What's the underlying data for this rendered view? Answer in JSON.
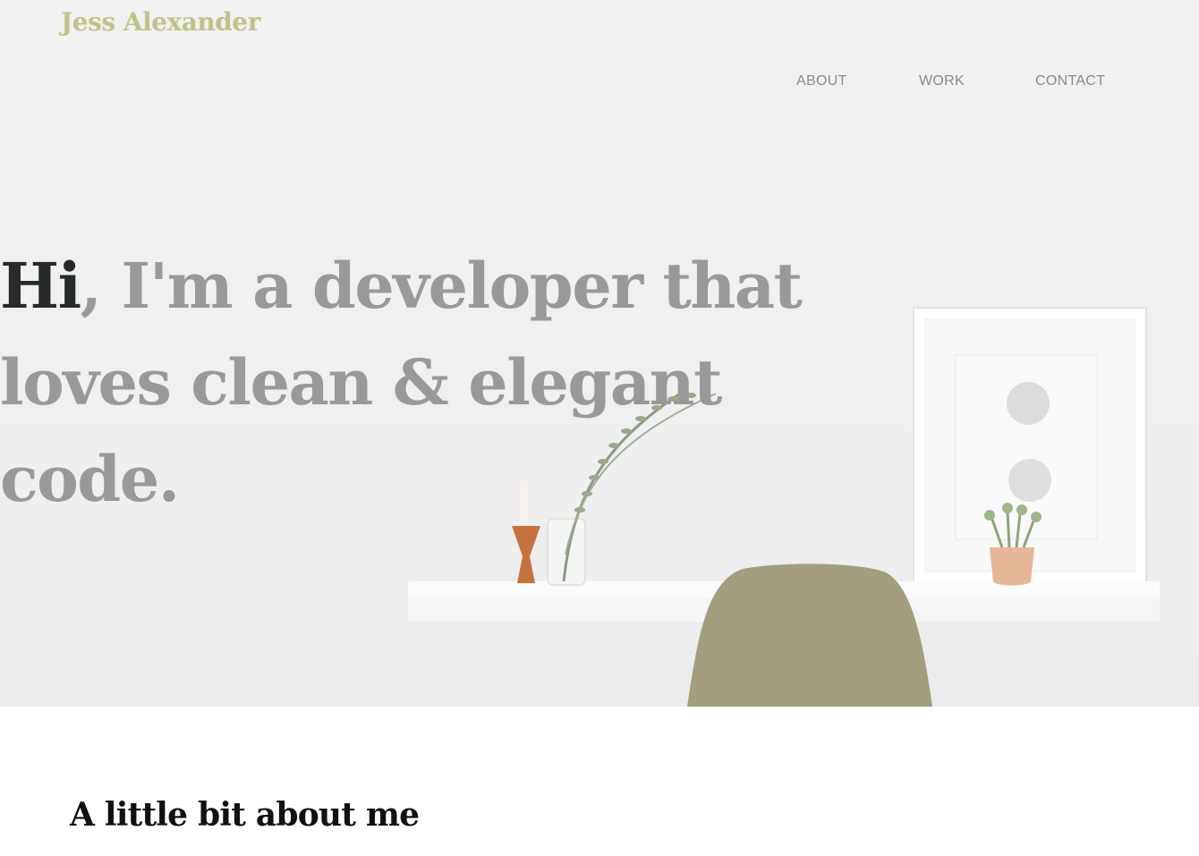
{
  "site": {
    "logo": "Jess Alexander"
  },
  "nav": {
    "items": [
      {
        "label": "ABOUT"
      },
      {
        "label": "WORK"
      },
      {
        "label": "CONTACT"
      }
    ]
  },
  "hero": {
    "greeting": "Hi",
    "headline_rest": "I'm a developer that loves clean & elegant code."
  },
  "about": {
    "title": "A little bit about me"
  },
  "colors": {
    "logo": "#bfc38a",
    "nav": "#8a8a8a",
    "headline": "#999999",
    "greeting": "#262b2a",
    "chair": "#a29e7e"
  }
}
